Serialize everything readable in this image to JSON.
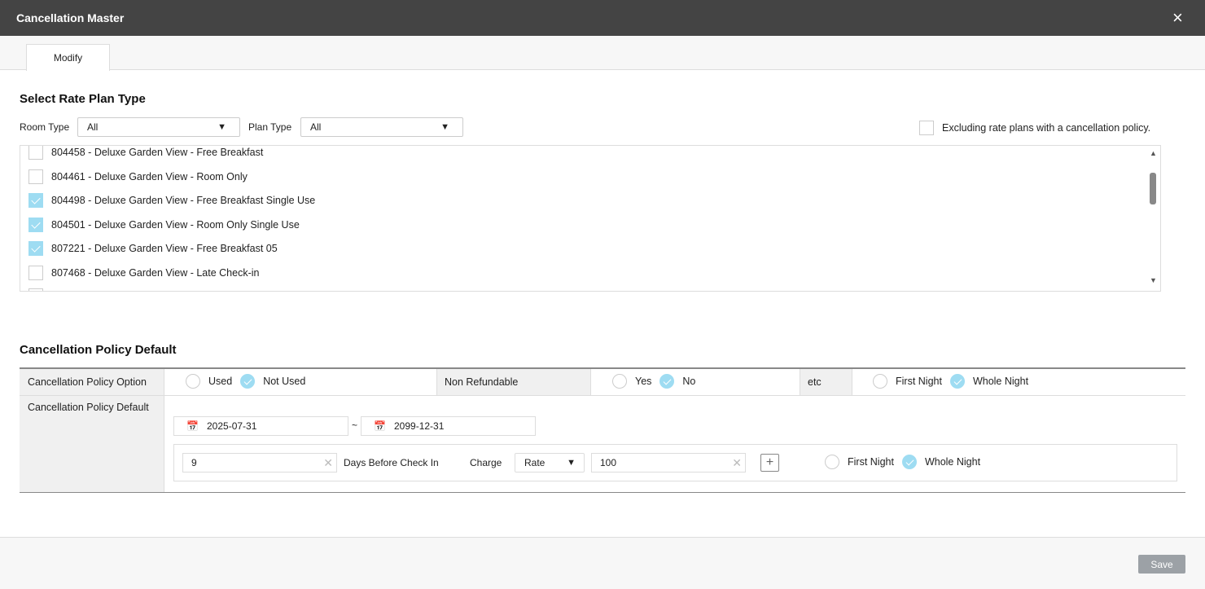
{
  "window": {
    "title": "Cancellation Master",
    "close_icon": "×"
  },
  "tabs": [
    {
      "label": "Modify"
    }
  ],
  "rate_plan": {
    "title": "Select Rate Plan Type",
    "room_type_label": "Room Type",
    "room_type_value": "All",
    "plan_type_label": "Plan Type",
    "plan_type_value": "All",
    "exclude_label": "Excluding rate plans with a cancellation policy.",
    "exclude_checked": false,
    "items": [
      {
        "label": "804458 - Deluxe Garden View - Free Breakfast",
        "checked": false
      },
      {
        "label": "804461 - Deluxe Garden View - Room Only",
        "checked": false
      },
      {
        "label": "804498 - Deluxe Garden View - Free Breakfast Single Use",
        "checked": true
      },
      {
        "label": "804501 - Deluxe Garden View - Room Only Single Use",
        "checked": true
      },
      {
        "label": "807221 - Deluxe Garden View - Free Breakfast 05",
        "checked": true
      },
      {
        "label": "807468 - Deluxe Garden View - Late Check-in",
        "checked": false
      }
    ]
  },
  "policy": {
    "title": "Cancellation Policy Default",
    "option_label": "Cancellation Policy Option",
    "used": "Used",
    "not_used": "Not Used",
    "non_refundable_label": "Non Refundable",
    "yes": "Yes",
    "no": "No",
    "etc_label": "etc",
    "first_night": "First Night",
    "whole_night": "Whole Night",
    "default_label": "Cancellation Policy Default",
    "date_from": "2025-07-31",
    "date_sep": "~",
    "date_to": "2099-12-31",
    "days": "9",
    "days_label": "Days Before Check In",
    "charge_label": "Charge",
    "charge_type": "Rate",
    "charge_value": "100",
    "add_icon": "+"
  },
  "footer": {
    "save_label": "Save"
  },
  "colors": {
    "header": "#444444",
    "accent": "#9edcf2"
  }
}
